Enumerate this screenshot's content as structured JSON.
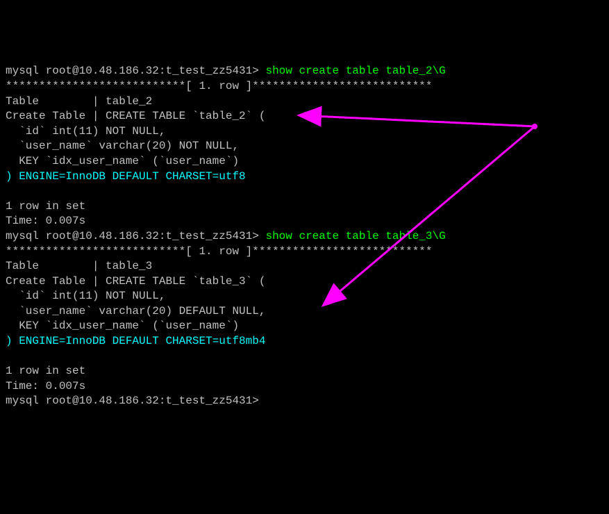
{
  "prompt_prefix": "mysql root@10.48.186.32:t_test_zz5431> ",
  "cmd1": "show create table table_2\\G",
  "row_sep": "***************************[ 1. row ]***************************",
  "t2_table_line": "Table        | table_2",
  "t2_create0": "Create Table | CREATE TABLE `table_2` (",
  "t2_create1": "  `id` int(11) NOT NULL,",
  "t2_create2": "  `user_name` varchar(20) NOT NULL,",
  "t2_create3": "  KEY `idx_user_name` (`user_name`)",
  "t2_create4": ") ENGINE=InnoDB DEFAULT CHARSET=utf8",
  "rows_in_set": "1 row in set",
  "time_line": "Time: 0.007s",
  "cmd2": "show create table table_3\\G",
  "t3_table_line": "Table        | table_3",
  "t3_create0": "Create Table | CREATE TABLE `table_3` (",
  "t3_create1": "  `id` int(11) NOT NULL,",
  "t3_create2": "  `user_name` varchar(20) DEFAULT NULL,",
  "t3_create3": "  KEY `idx_user_name` (`user_name`)",
  "t3_create4": ") ENGINE=InnoDB DEFAULT CHARSET=utf8mb4",
  "blank": ""
}
